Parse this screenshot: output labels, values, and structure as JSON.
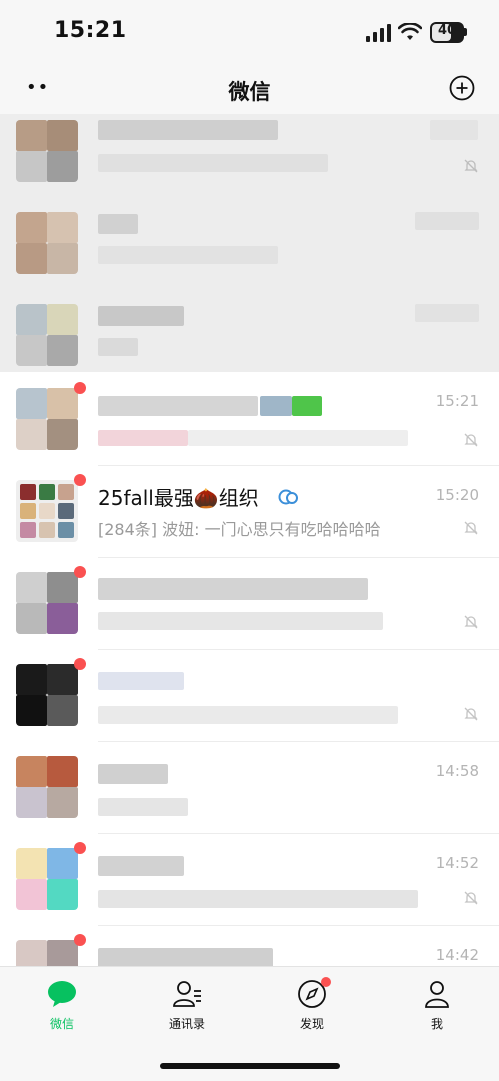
{
  "status": {
    "time": "15:21",
    "battery": "40"
  },
  "header": {
    "title": "微信",
    "more_icon": "more-dots-icon",
    "add_icon": "plus-circle-icon"
  },
  "chats": [
    {
      "name": "",
      "preview": "",
      "time": "",
      "muted": true,
      "pinned": true
    },
    {
      "name": "",
      "preview": "",
      "time": "",
      "muted": false,
      "pinned": true
    },
    {
      "name": "",
      "preview": "",
      "time": "",
      "muted": false,
      "pinned": true
    },
    {
      "name": "",
      "preview": "",
      "time": "15:21",
      "muted": true,
      "unread": true
    },
    {
      "name": "25fall最强🌰组织",
      "preview": "[284条] 波妞: 一门心思只有吃哈哈哈哈",
      "time": "15:20",
      "muted": true,
      "unread": true
    },
    {
      "name": "",
      "preview": "",
      "time": "",
      "muted": true,
      "unread": true
    },
    {
      "name": "",
      "preview": "",
      "time": "",
      "muted": true,
      "unread": true
    },
    {
      "name": "",
      "preview": "",
      "time": "14:58",
      "muted": false
    },
    {
      "name": "",
      "preview": "",
      "time": "14:52",
      "muted": true,
      "unread": true
    },
    {
      "name": "",
      "preview": "",
      "time": "14:42",
      "muted": false,
      "unread": true
    }
  ],
  "tabs": [
    {
      "label": "微信",
      "icon": "chat-bubble-icon",
      "active": true
    },
    {
      "label": "通讯录",
      "icon": "contacts-icon"
    },
    {
      "label": "发现",
      "icon": "compass-icon",
      "badge": true
    },
    {
      "label": "我",
      "icon": "profile-icon"
    }
  ],
  "colors": {
    "accent": "#07c160",
    "badge": "#fa5151",
    "muted_text": "#9a9a9a",
    "time_text": "#b4b4b4",
    "pinned_bg": "#ededed"
  }
}
